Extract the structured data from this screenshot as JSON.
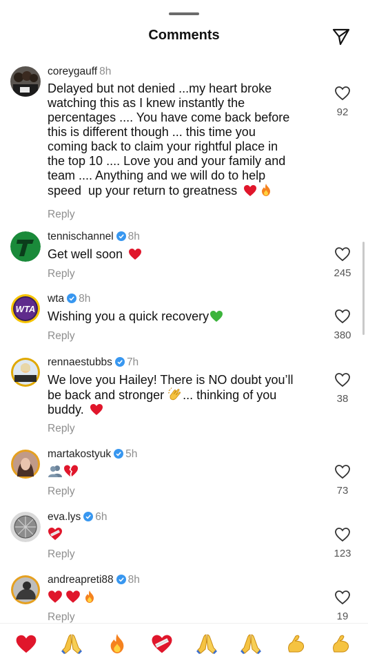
{
  "header": {
    "title": "Comments",
    "share_icon": "send-icon"
  },
  "comments": [
    {
      "username": "coreygauff",
      "verified": false,
      "time": "8h",
      "lines": [
        "Delayed but not denied ...my heart broke",
        "watching this as I knew instantly the",
        "percentages .... You have come back before",
        "this is different though ... this time you",
        "coming back to claim your rightful place in",
        "the top 10 .... Love you and your family and",
        "team .... Anything and we will do to help",
        "speed  up your return to greatness"
      ],
      "emojis": [
        "red-heart",
        "fire"
      ],
      "reply": "Reply",
      "likes": "92"
    },
    {
      "username": "tennischannel",
      "verified": true,
      "time": "8h",
      "lines": [
        "Get well soon"
      ],
      "emojis": [
        "red-heart"
      ],
      "reply": "Reply",
      "likes": "245"
    },
    {
      "username": "wta",
      "verified": true,
      "time": "8h",
      "avatar_text": "WTA",
      "lines": [
        "Wishing you a quick recovery"
      ],
      "emojis": [
        "green-heart"
      ],
      "reply": "Reply",
      "likes": "380"
    },
    {
      "username": "rennaestubbs",
      "verified": true,
      "time": "7h",
      "lines": [
        "We love you Hailey! There is NO doubt you’ll",
        "be back and stronger",
        "buddy."
      ],
      "inline_after_line2": "... thinking of you",
      "emojis": [
        "clapping-hands",
        "red-heart"
      ],
      "reply": "Reply",
      "likes": "38"
    },
    {
      "username": "martakostyuk",
      "verified": true,
      "time": "5h",
      "lines": [],
      "emojis": [
        "people-silhouette",
        "broken-heart"
      ],
      "reply": "Reply",
      "likes": "73"
    },
    {
      "username": "eva.lys",
      "verified": true,
      "time": "6h",
      "lines": [],
      "emojis": [
        "mending-heart"
      ],
      "reply": "Reply",
      "likes": "123"
    },
    {
      "username": "andreapreti88",
      "verified": true,
      "time": "8h",
      "lines": [],
      "emojis": [
        "red-heart",
        "red-heart",
        "fire"
      ],
      "reply": "Reply",
      "likes": "19"
    }
  ],
  "quick_reactions": [
    "red-heart",
    "folded-hands",
    "fire",
    "mending-heart",
    "folded-hands",
    "folded-hands",
    "flexed-biceps",
    "flexed-biceps"
  ],
  "colors": {
    "heart_red": "#e0162b",
    "verified_blue": "#3897f0",
    "muted": "#8e8e8e"
  }
}
